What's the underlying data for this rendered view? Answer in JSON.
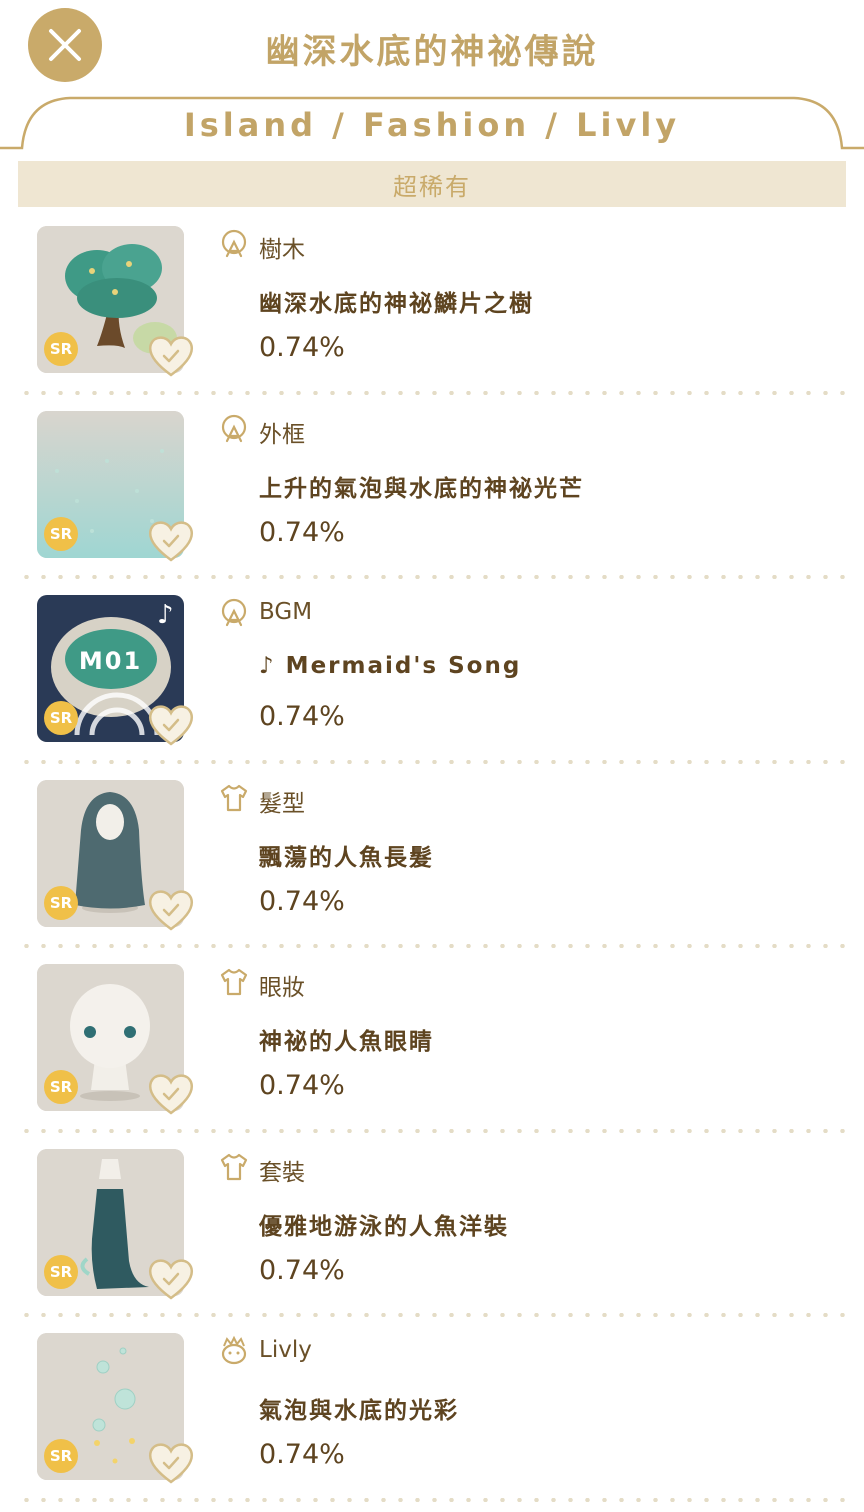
{
  "header": {
    "title": "幽深水底的神祕傳說",
    "close_icon": "close-icon"
  },
  "subtitle": "Island / Fashion / Livly",
  "rarity_label": "超稀有",
  "colors": {
    "gold": "#c9aa6a",
    "cream": "#efe6d2",
    "text": "#5e4420",
    "badge": "#f0c048"
  },
  "items": [
    {
      "category": "樹木",
      "name": "幽深水底的神祕鱗片之樹",
      "rate": "0.74%",
      "badge": "SR",
      "icon": "island-icon",
      "thumb": "tree"
    },
    {
      "category": "外框",
      "name": "上升的氣泡與水底的神祕光芒",
      "rate": "0.74%",
      "badge": "SR",
      "icon": "island-icon",
      "thumb": "frame"
    },
    {
      "category": "BGM",
      "name": "♪ Mermaid's Song",
      "rate": "0.74%",
      "badge": "SR",
      "icon": "island-icon",
      "thumb": "bgm",
      "thumb_text": "M01"
    },
    {
      "category": "髮型",
      "name": "飄蕩的人魚長髮",
      "rate": "0.74%",
      "badge": "SR",
      "icon": "shirt-icon",
      "thumb": "hair"
    },
    {
      "category": "眼妝",
      "name": "神祕的人魚眼睛",
      "rate": "0.74%",
      "badge": "SR",
      "icon": "shirt-icon",
      "thumb": "eyes"
    },
    {
      "category": "套裝",
      "name": "優雅地游泳的人魚洋裝",
      "rate": "0.74%",
      "badge": "SR",
      "icon": "shirt-icon",
      "thumb": "dress"
    },
    {
      "category": "Livly",
      "name": "氣泡與水底的光彩",
      "rate": "0.74%",
      "badge": "SR",
      "icon": "livly-icon",
      "thumb": "bubbles"
    }
  ]
}
